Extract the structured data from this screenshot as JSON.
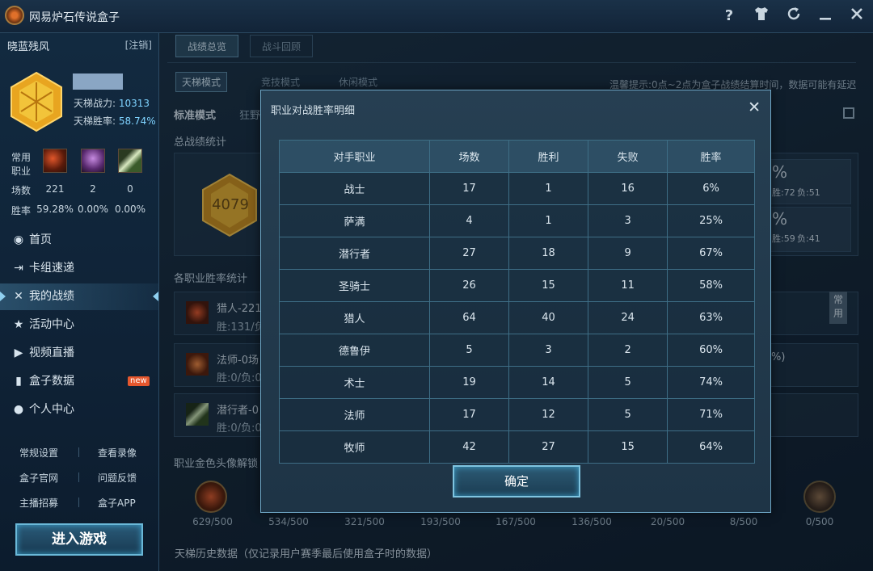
{
  "titlebar": {
    "title": "网易炉石传说盒子"
  },
  "sidebar": {
    "username": "晓蓝残风",
    "logout": "[注销]",
    "ladder_power_label": "天梯战力:",
    "ladder_power_value": "10313",
    "ladder_winrate_label": "天梯胜率:",
    "ladder_winrate_value": "58.74%",
    "common_class_label_1": "常用",
    "common_class_label_2": "职业",
    "games_label": "场数",
    "winrate_label": "胜率",
    "classes": [
      {
        "games": "221",
        "winrate": "59.28%"
      },
      {
        "games": "2",
        "winrate": "0.00%"
      },
      {
        "games": "0",
        "winrate": "0.00%"
      }
    ],
    "nav": [
      {
        "label": "首页",
        "icon": "home-icon"
      },
      {
        "label": "卡组速递",
        "icon": "deck-icon"
      },
      {
        "label": "我的战绩",
        "icon": "swords-icon"
      },
      {
        "label": "活动中心",
        "icon": "star-icon"
      },
      {
        "label": "视频直播",
        "icon": "video-icon"
      },
      {
        "label": "盒子数据",
        "icon": "chart-icon",
        "badge": "new"
      },
      {
        "label": "个人中心",
        "icon": "person-icon"
      }
    ],
    "links": [
      "常规设置",
      "查看录像",
      "盒子官网",
      "问题反馈",
      "主播招募",
      "盒子APP"
    ],
    "play_button": "进入游戏"
  },
  "main": {
    "tabs": [
      "战绩总览",
      "战斗回顾"
    ],
    "subtabs": [
      "天梯模式",
      "竞技模式",
      "休闲模式"
    ],
    "hint": "温馨提示:0点~2点为盒子战绩结算时间，数据可能有延迟",
    "modes": [
      "标准模式",
      "狂野"
    ],
    "section_total": "总战绩统计",
    "rank_value": "4079",
    "right_partial": [
      {
        "pct": "%",
        "w": "胜:72",
        "l": "负:51"
      },
      {
        "pct": "%",
        "w": "胜:59",
        "l": "负:41"
      }
    ],
    "section_class": "各职业胜率统计",
    "class_rows": [
      {
        "name": "猎人-221",
        "detail": "胜:131/负"
      },
      {
        "name": "法师-0场",
        "detail": "胜:0/负:0"
      },
      {
        "name": "潜行者-0",
        "detail": "胜:0/负:0"
      }
    ],
    "badge_common": "常用",
    "partial_right_text": "%)",
    "section_gold": "职业金色头像解锁",
    "gold_values": [
      "629/500",
      "534/500",
      "321/500",
      "193/500",
      "167/500",
      "136/500",
      "20/500",
      "8/500",
      "0/500"
    ],
    "section_history": "天梯历史数据（仅记录用户赛季最后使用盒子时的数据）"
  },
  "dialog": {
    "title": "职业对战胜率明细",
    "headers": [
      "对手职业",
      "场数",
      "胜利",
      "失败",
      "胜率"
    ],
    "rows": [
      [
        "战士",
        "17",
        "1",
        "16",
        "6%"
      ],
      [
        "萨满",
        "4",
        "1",
        "3",
        "25%"
      ],
      [
        "潜行者",
        "27",
        "18",
        "9",
        "67%"
      ],
      [
        "圣骑士",
        "26",
        "15",
        "11",
        "58%"
      ],
      [
        "猎人",
        "64",
        "40",
        "24",
        "63%"
      ],
      [
        "德鲁伊",
        "5",
        "3",
        "2",
        "60%"
      ],
      [
        "术士",
        "19",
        "14",
        "5",
        "74%"
      ],
      [
        "法师",
        "17",
        "12",
        "5",
        "71%"
      ],
      [
        "牧师",
        "42",
        "27",
        "15",
        "64%"
      ]
    ],
    "confirm": "确定"
  }
}
